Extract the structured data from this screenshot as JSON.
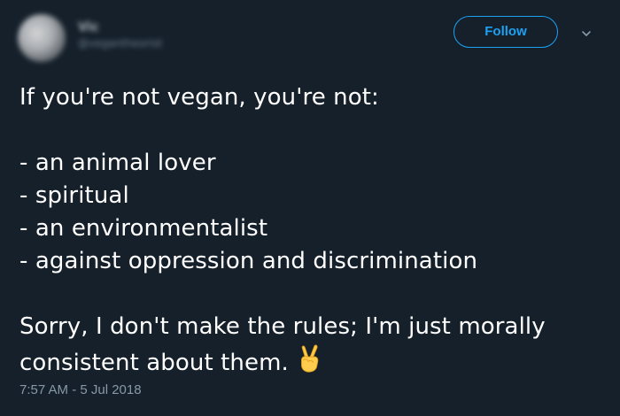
{
  "header": {
    "name": "Vic",
    "handle": "@vegantheorist",
    "follow_label": "Follow",
    "caret_icon": "chevron-down-icon"
  },
  "tweet": {
    "line1": "If you're not vegan, you're not:",
    "items": [
      "- an animal lover",
      "- spiritual",
      "- an environmentalist",
      "- against oppression and discrimination"
    ],
    "closing_line1": "Sorry, I don't make the rules; I'm just morally",
    "closing_line2": "consistent about them.",
    "emoji": "victory-hand-emoji"
  },
  "meta": {
    "timestamp": "7:57 AM - 5 Jul 2018"
  },
  "colors": {
    "background": "#15202b",
    "accent": "#1da1f2",
    "secondary_text": "#8899a6"
  }
}
